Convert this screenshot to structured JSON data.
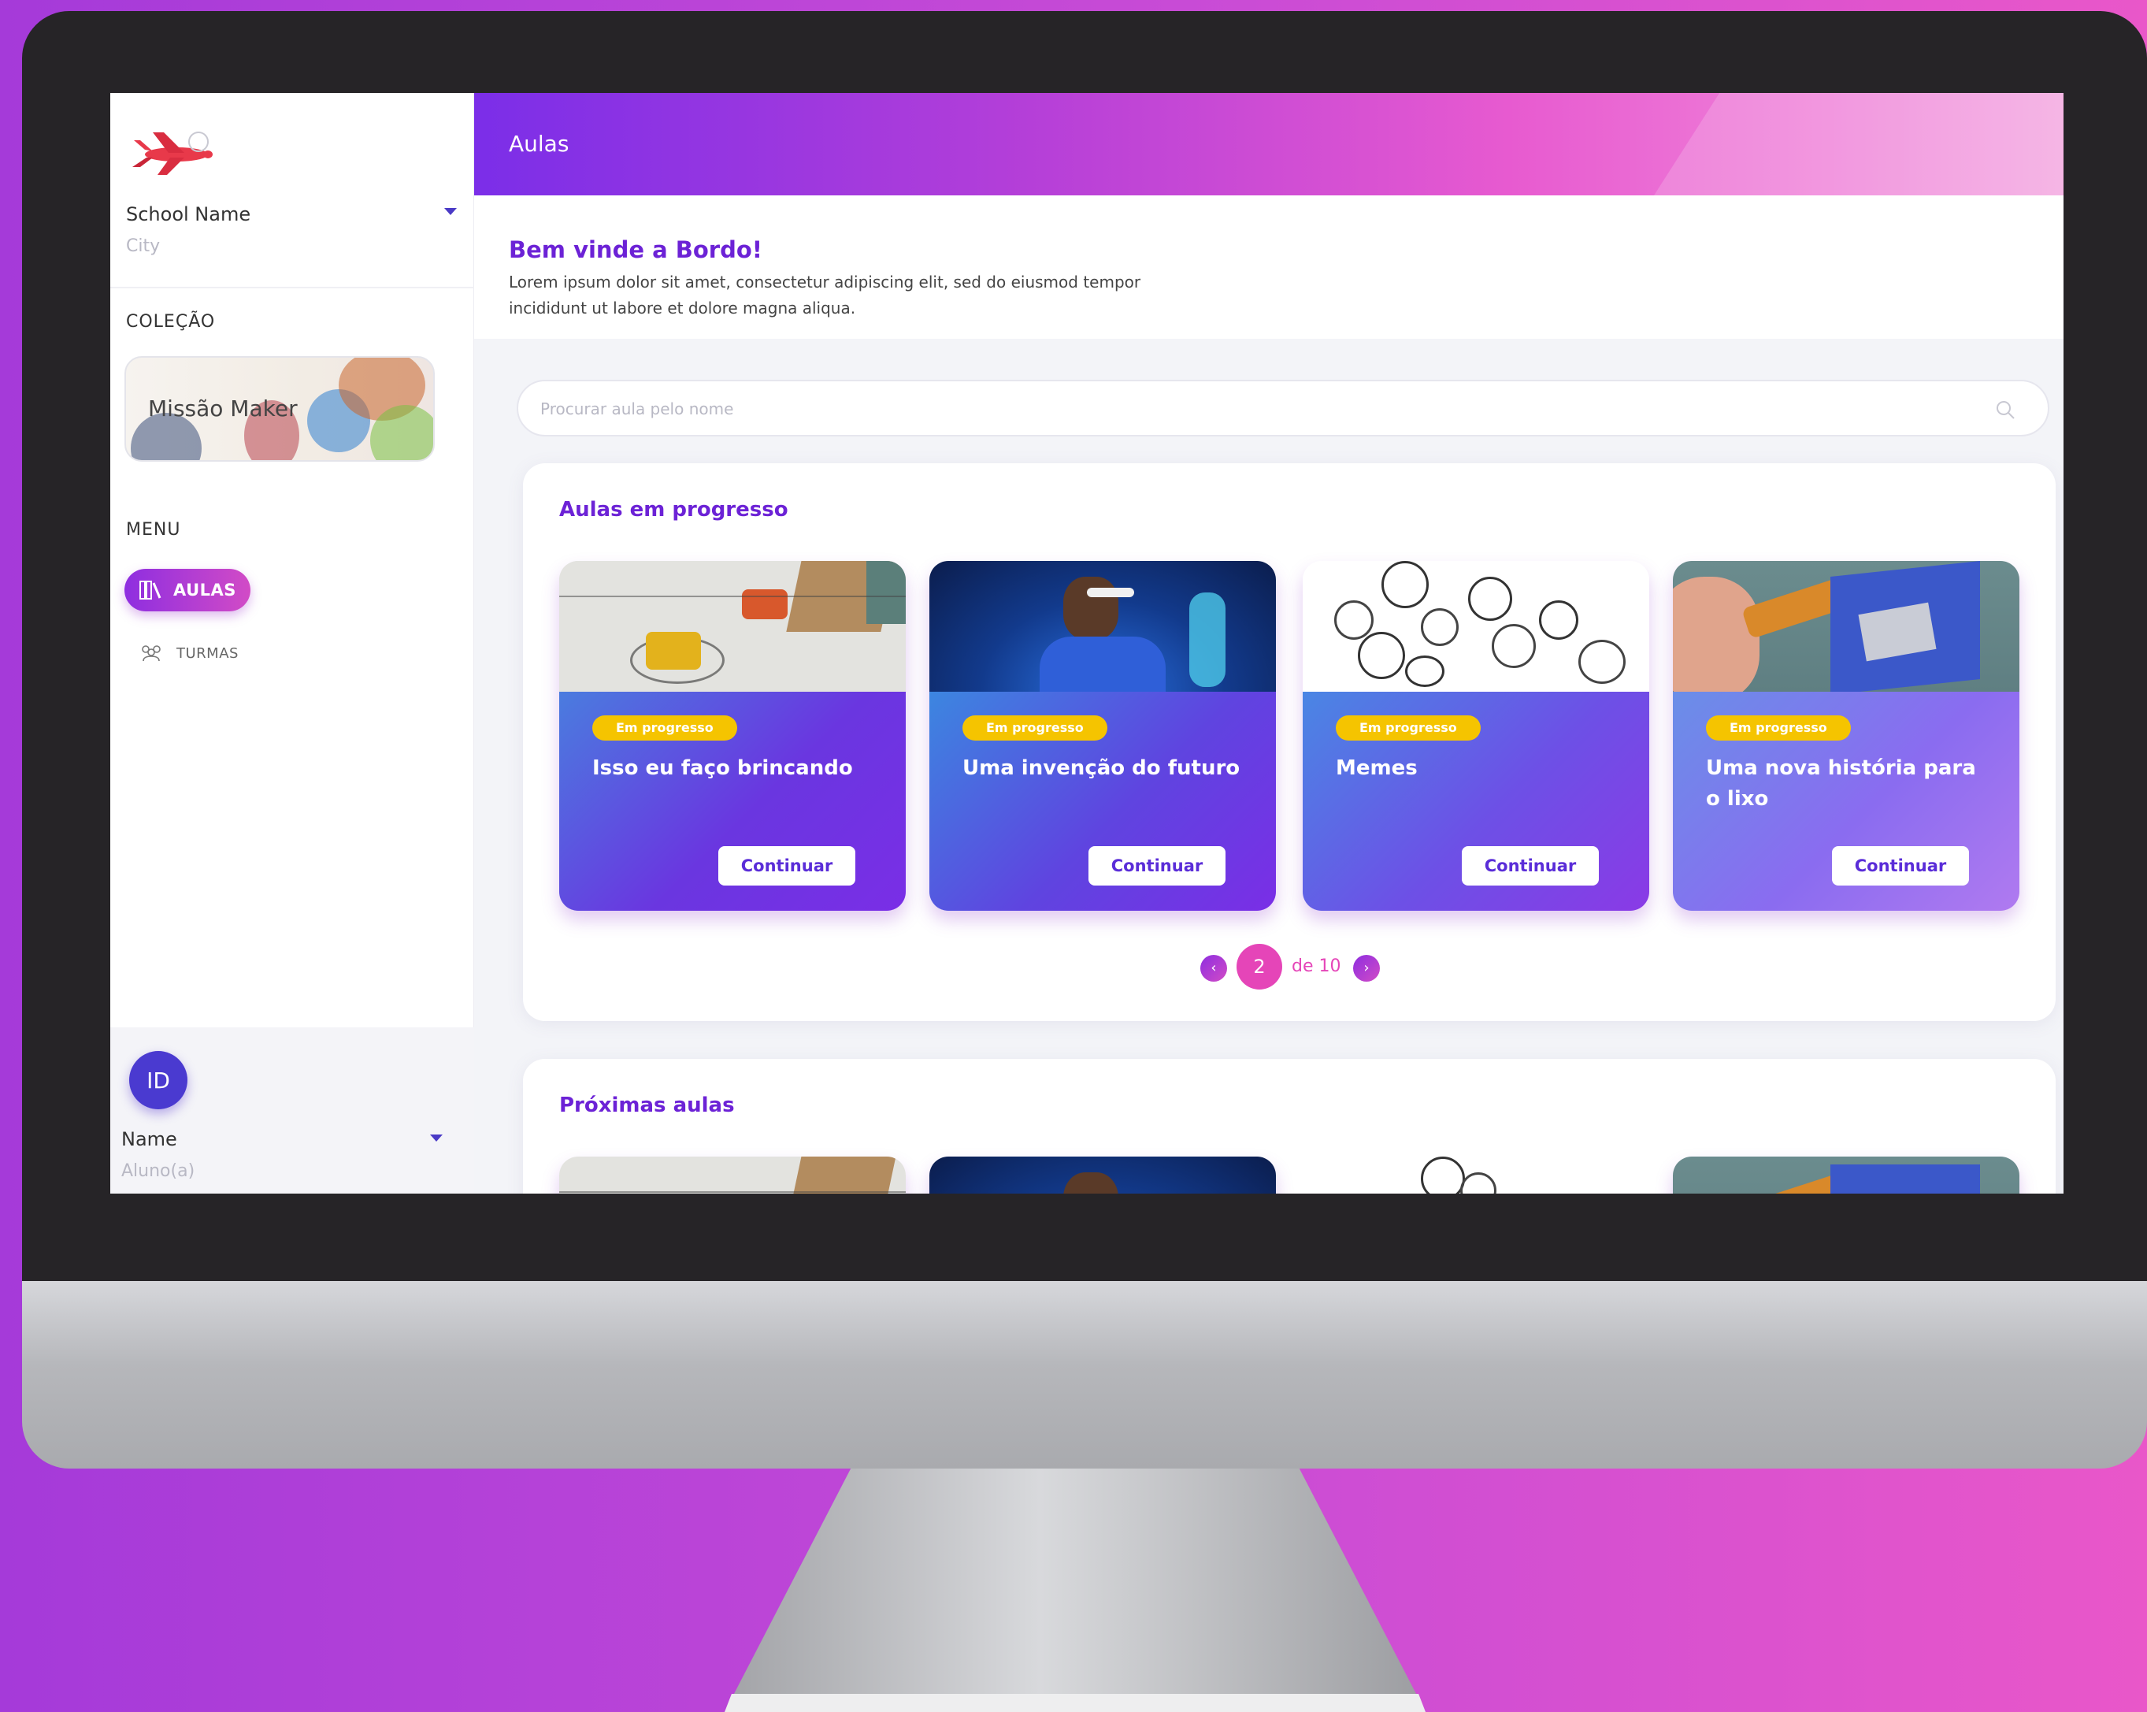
{
  "header": {
    "title": "Aulas"
  },
  "sidebar": {
    "school": {
      "name": "School Name",
      "city": "City"
    },
    "collection_label": "COLEÇÃO",
    "collection_card": {
      "title": "Missão Maker"
    },
    "menu_label": "MENU",
    "menu": [
      {
        "label": "AULAS",
        "icon": "books-icon",
        "active": true
      },
      {
        "label": "TURMAS",
        "icon": "group-icon",
        "active": false
      }
    ],
    "user": {
      "initials": "ID",
      "name": "Name",
      "role": "Aluno(a)"
    }
  },
  "welcome": {
    "title": "Bem vinde a Bordo!",
    "text": "Lorem ipsum dolor sit amet, consectetur adipiscing elit, sed do eiusmod tempor incididunt ut labore et dolore magna aliqua."
  },
  "search": {
    "placeholder": "Procurar aula pelo nome",
    "icon": "search-icon"
  },
  "in_progress": {
    "title": "Aulas em progresso",
    "cards": [
      {
        "badge": "Em progresso",
        "title": "Isso eu faço brincando",
        "button": "Continuar"
      },
      {
        "badge": "Em progresso",
        "title": "Uma invenção do futuro",
        "button": "Continuar"
      },
      {
        "badge": "Em progresso",
        "title": "Memes",
        "button": "Continuar"
      },
      {
        "badge": "Em progresso",
        "title": "Uma nova história para o lixo",
        "button": "Continuar"
      }
    ],
    "pagination": {
      "current": "2",
      "total_text": "de 10",
      "prev": "‹",
      "next": "›"
    }
  },
  "upcoming": {
    "title": "Próximas aulas"
  },
  "colors": {
    "accent": "#6c22d6",
    "badge": "#f5c400",
    "pagination": "#e545b8",
    "gradient_start": "#7b2ee8",
    "gradient_end": "#f3a6e0"
  }
}
